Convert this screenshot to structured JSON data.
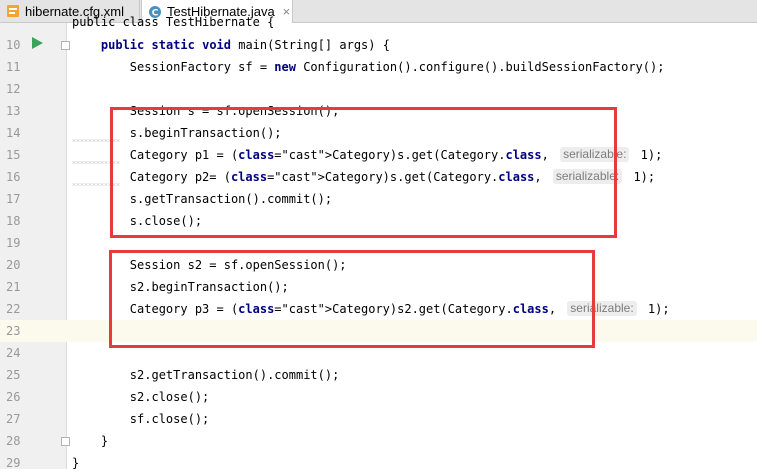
{
  "tabs": [
    {
      "label": "hibernate.cfg.xml",
      "icon": "xml-file-icon",
      "active": false
    },
    {
      "label": "TestHibernate.java",
      "icon": "java-class-icon",
      "active": true,
      "close": "×"
    }
  ],
  "editor": {
    "top_partial": "public class TestHibernate {",
    "lines": [
      {
        "n": "10",
        "text": "    public static void main(String[] args) {"
      },
      {
        "n": "11",
        "text": "        SessionFactory sf = new Configuration().configure().buildSessionFactory();"
      },
      {
        "n": "12",
        "text": ""
      },
      {
        "n": "13",
        "text": "        Session s = sf.openSession();"
      },
      {
        "n": "14",
        "text": "        s.beginTransaction();"
      },
      {
        "n": "15",
        "pre": "        Category p1 = (Category)s.get(Category.",
        "kw": "class",
        "mid": ",",
        "hint": "serializable:",
        "post": " 1);"
      },
      {
        "n": "16",
        "pre": "        Category p2= (Category)s.get(Category.",
        "kw": "class",
        "mid": ",",
        "hint": "serializable:",
        "post": " 1);"
      },
      {
        "n": "17",
        "text": "        s.getTransaction().commit();"
      },
      {
        "n": "18",
        "text": "        s.close();"
      },
      {
        "n": "19",
        "text": ""
      },
      {
        "n": "20",
        "text": "        Session s2 = sf.openSession();"
      },
      {
        "n": "21",
        "text": "        s2.beginTransaction();"
      },
      {
        "n": "22",
        "pre": "        Category p3 = (Category)s2.get(Category.",
        "kw": "class",
        "mid": ",",
        "hint": "serializable:",
        "post": " 1);"
      },
      {
        "n": "23",
        "text": ""
      },
      {
        "n": "24",
        "text": ""
      },
      {
        "n": "25",
        "text": "        s2.getTransaction().commit();"
      },
      {
        "n": "26",
        "text": "        s2.close();"
      },
      {
        "n": "27",
        "text": "        sf.close();"
      },
      {
        "n": "28",
        "text": "    }"
      },
      {
        "n": "29",
        "text": "}"
      }
    ]
  },
  "colors": {
    "highlight_box": "#e53b3b",
    "keyword": "#000080",
    "run": "#3aa55a"
  }
}
